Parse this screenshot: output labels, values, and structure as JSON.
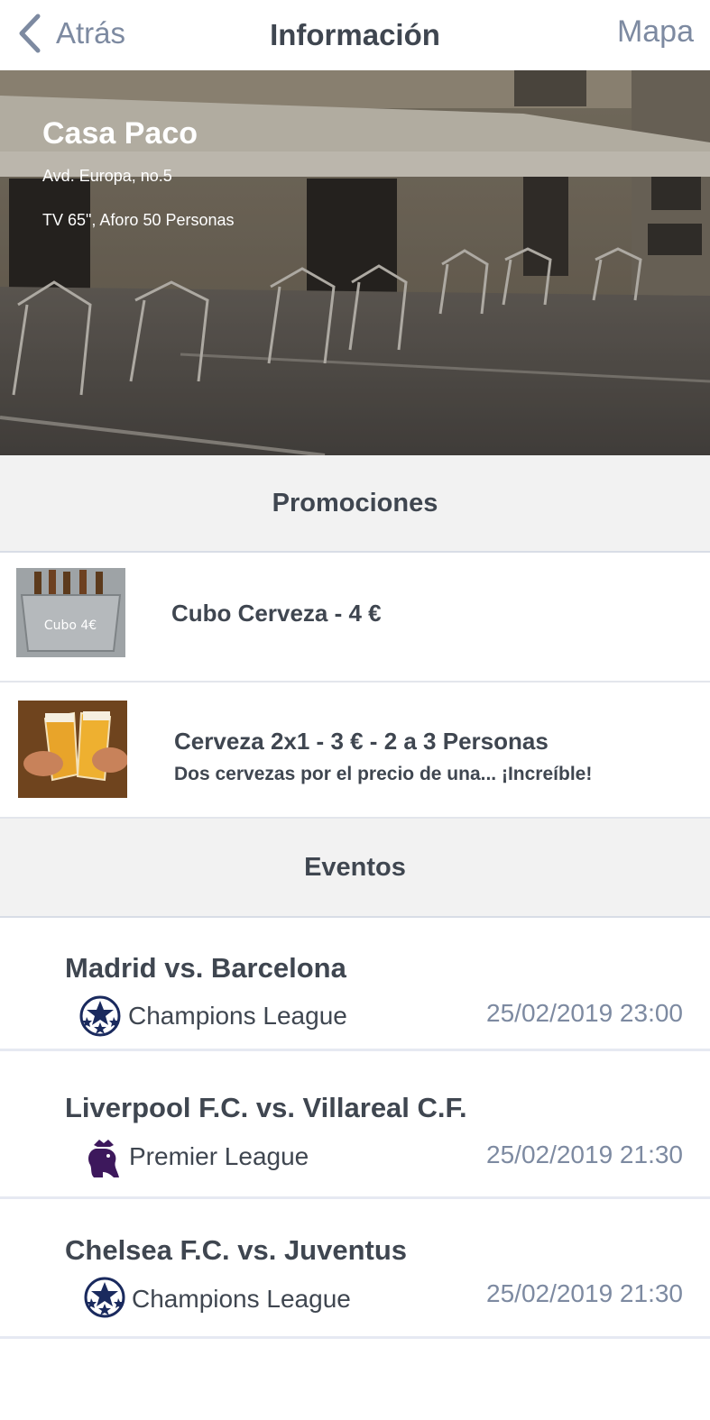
{
  "nav": {
    "back_label": "Atrás",
    "title": "Información",
    "map_label": "Mapa"
  },
  "venue": {
    "name": "Casa Paco",
    "address": "Avd. Europa, no.5",
    "details": "TV 65\", Aforo 50 Personas",
    "image_icon": "bar-terrace-photo"
  },
  "promotions": {
    "header": "Promociones",
    "items": [
      {
        "title": "Cubo Cerveza - 4 €",
        "subtitle": "",
        "thumb_icon": "beer-bucket-image"
      },
      {
        "title": "Cerveza 2x1 - 3 € - 2 a 3 Personas",
        "subtitle": "Dos cervezas por el precio de una... ¡Increíble!",
        "thumb_icon": "beer-toast-image"
      }
    ]
  },
  "events": {
    "header": "Eventos",
    "items": [
      {
        "name": "Madrid vs. Barcelona",
        "league": "Champions League",
        "league_icon": "champions-league-icon",
        "datetime": "25/02/2019 23:00"
      },
      {
        "name": "Liverpool F.C. vs. Villareal C.F.",
        "league": "Premier League",
        "league_icon": "premier-league-icon",
        "datetime": "25/02/2019 21:30"
      },
      {
        "name": "Chelsea F.C. vs. Juventus",
        "league": "Champions League",
        "league_icon": "champions-league-icon",
        "datetime": "25/02/2019 21:30"
      }
    ]
  },
  "colors": {
    "accent": "#7d8aa1",
    "text": "#3f4650",
    "section_bg": "#f2f2f2",
    "league_purple": "#3d185c",
    "champions_navy": "#1a2a5e"
  }
}
